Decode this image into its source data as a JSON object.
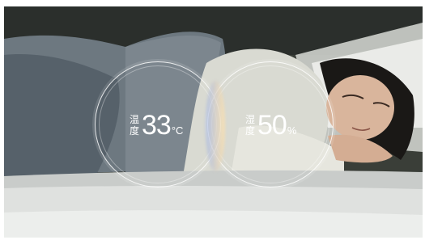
{
  "temperature": {
    "label_line1": "温",
    "label_line2": "度",
    "value": "33",
    "unit": "°C"
  },
  "humidity": {
    "label_line1": "湿",
    "label_line2": "度",
    "value": "50",
    "unit": "%"
  }
}
